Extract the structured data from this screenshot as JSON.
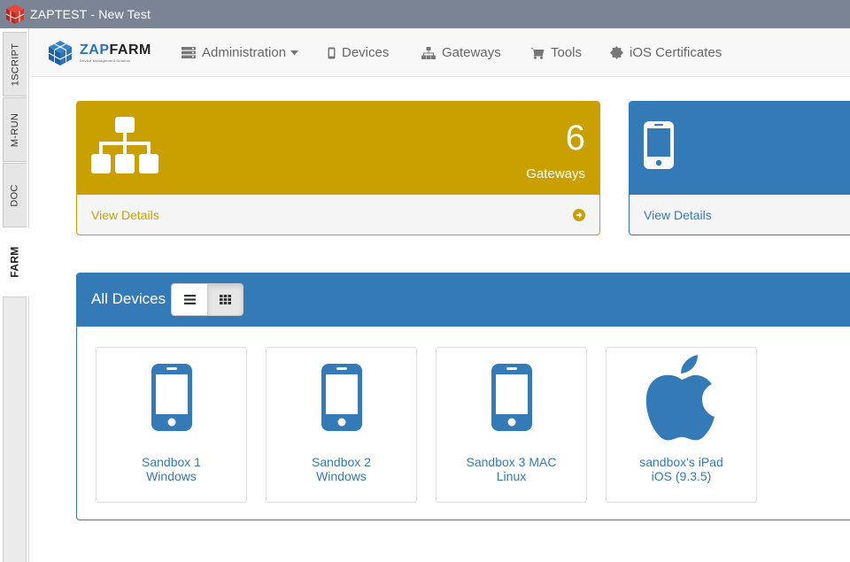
{
  "window": {
    "title": "ZAPTEST - New Test"
  },
  "sidetabs": [
    {
      "label": "1SCRIPT"
    },
    {
      "label": "M-RUN"
    },
    {
      "label": "DOC"
    },
    {
      "label": "FARM"
    }
  ],
  "brand": {
    "zap": "ZAP",
    "farm": "FARM",
    "tagline": "Device Management Solution"
  },
  "nav": {
    "administration": "Administration",
    "devices": "Devices",
    "gateways": "Gateways",
    "tools": "Tools",
    "ios_certificates": "iOS Certificates"
  },
  "gateways_panel": {
    "count": "6",
    "label": "Gateways",
    "link": "View Details"
  },
  "devices_panel": {
    "link": "View Details"
  },
  "all_devices": {
    "title": "All Devices",
    "devices": [
      {
        "line1": "Sandbox 1",
        "line2": "Windows",
        "icon": "mobile-phone-icon"
      },
      {
        "line1": "Sandbox 2",
        "line2": "Windows",
        "icon": "mobile-phone-icon"
      },
      {
        "line1": "Sandbox 3 MAC",
        "line2": "Linux",
        "icon": "mobile-phone-icon"
      },
      {
        "line1": "sandbox's iPad",
        "line2": "iOS (9.3.5)",
        "icon": "apple-icon"
      }
    ]
  },
  "colors": {
    "gold": "#c9a000",
    "blue": "#337ab7",
    "titlebar": "#7a8494"
  }
}
